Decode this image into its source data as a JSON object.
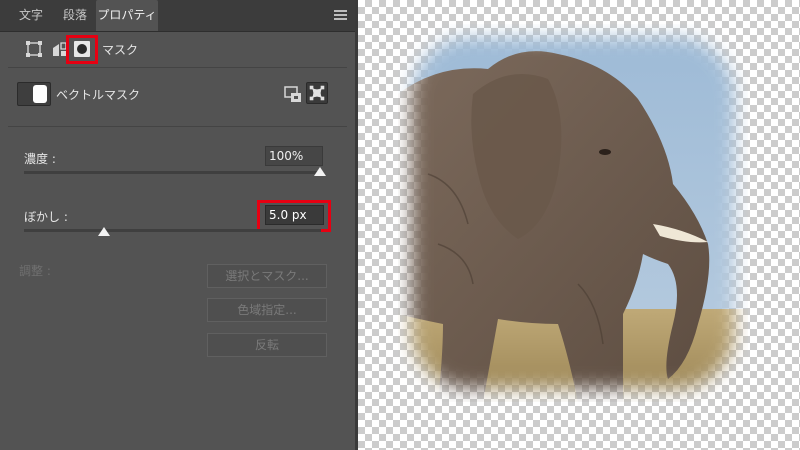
{
  "tabs": [
    {
      "label": "文字",
      "active": false
    },
    {
      "label": "段落",
      "active": false
    },
    {
      "label": "プロパティ",
      "active": true
    }
  ],
  "panel_menu_icon": "hamburger-icon",
  "mask_section": {
    "title": "マスク",
    "mode_icons": [
      "pixel-transform-icon",
      "layer-stack-icon",
      "layer-mask-icon"
    ],
    "highlight_color": "#e60012"
  },
  "vector_mask": {
    "label": "ベクトルマスク",
    "icons": [
      "select-mask-icon",
      "add-vector-mask-icon"
    ]
  },
  "density": {
    "label": "濃度 :",
    "value": "100%",
    "level_percent": 100
  },
  "feather": {
    "label": "ぼかし :",
    "value": "5.0 px",
    "level_fraction": 0.27
  },
  "adjust": {
    "label": "調整 :",
    "buttons": [
      "選択とマスク...",
      "色域指定...",
      "反転"
    ]
  },
  "canvas": {
    "subject": "elephant photo with soft feathered rounded mask",
    "background": "transparency-checkerboard"
  }
}
